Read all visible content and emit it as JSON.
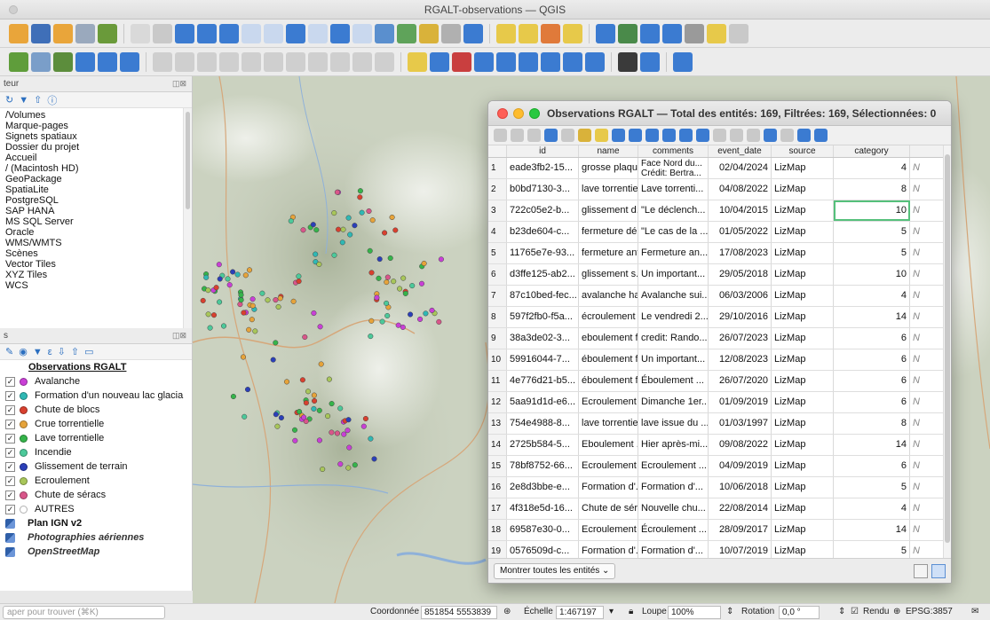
{
  "window": {
    "title": "RGALT-observations — QGIS"
  },
  "browser": {
    "title": "teur",
    "items": [
      "/Volumes",
      "Marque-pages",
      "Signets spatiaux",
      "Dossier du projet",
      "Accueil",
      "/ (Macintosh HD)",
      "GeoPackage",
      "SpatiaLite",
      "PostgreSQL",
      "SAP HANA",
      "MS SQL Server",
      "Oracle",
      "WMS/WMTS",
      "Scènes",
      "Vector Tiles",
      "XYZ Tiles",
      "WCS"
    ]
  },
  "layers": {
    "title": "s",
    "group": "Observations RGALT",
    "items": [
      {
        "label": "Avalanche",
        "color": "#c93fd6"
      },
      {
        "label": "Formation d'un nouveau lac glacia",
        "color": "#2fb8b4"
      },
      {
        "label": "Chute de blocs",
        "color": "#d8402f"
      },
      {
        "label": "Crue torrentielle",
        "color": "#e6a33a"
      },
      {
        "label": "Lave torrentielle",
        "color": "#35b44a"
      },
      {
        "label": "Incendie",
        "color": "#4cc99a"
      },
      {
        "label": "Glissement de terrain",
        "color": "#2b3fb8"
      },
      {
        "label": "Ecroulement",
        "color": "#a8c65a"
      },
      {
        "label": "Chute de séracs",
        "color": "#d9568a"
      },
      {
        "label": "AUTRES",
        "color": "#ffffff"
      }
    ],
    "basemaps": [
      "Plan IGN v2",
      "Photographies aériennes",
      "OpenStreetMap"
    ]
  },
  "attribute_table": {
    "title": "Observations RGALT — Total des entités: 169, Filtrées: 169, Sélectionnées: 0",
    "columns": [
      "id",
      "name",
      "comments",
      "event_date",
      "source",
      "category"
    ],
    "rows": [
      {
        "n": "1",
        "id": "eade3fb2-15...",
        "name": "grosse plaqu...",
        "comments": "Face Nord du...",
        "comments2": "Crédit: Bertra...",
        "date": "02/04/2024",
        "source": "LizMap",
        "category": "4",
        "extra": "N"
      },
      {
        "n": "2",
        "id": "b0bd7130-3...",
        "name": "lave torrentie...",
        "comments": "Lave torrenti...",
        "date": "04/08/2022",
        "source": "LizMap",
        "category": "8",
        "extra": "N"
      },
      {
        "n": "3",
        "id": "722c05e2-b...",
        "name": "glissement d...",
        "comments": "\"Le déclench...",
        "date": "10/04/2015",
        "source": "LizMap",
        "category": "10",
        "extra": "N"
      },
      {
        "n": "4",
        "id": "b23de604-c...",
        "name": "fermeture dé...",
        "comments": "\"Le cas de la ...",
        "date": "01/05/2022",
        "source": "LizMap",
        "category": "5",
        "extra": "N"
      },
      {
        "n": "5",
        "id": "11765e7e-93...",
        "name": "fermeture ant...",
        "comments": "Fermeture an...",
        "date": "17/08/2023",
        "source": "LizMap",
        "category": "5",
        "extra": "N"
      },
      {
        "n": "6",
        "id": "d3ffe125-ab2...",
        "name": "glissement s...",
        "comments": "Un important...",
        "date": "29/05/2018",
        "source": "LizMap",
        "category": "10",
        "extra": "N"
      },
      {
        "n": "7",
        "id": "87c10bed-fec...",
        "name": "avalanche ha...",
        "comments": "Avalanche sui...",
        "date": "06/03/2006",
        "source": "LizMap",
        "category": "4",
        "extra": "N"
      },
      {
        "n": "8",
        "id": "597f2fb0-f5a...",
        "name": "écroulement ...",
        "comments": "Le vendredi 2...",
        "date": "29/10/2016",
        "source": "LizMap",
        "category": "14",
        "extra": "N"
      },
      {
        "n": "9",
        "id": "38a3de02-3...",
        "name": "eboulement f...",
        "comments": "credit: Rando...",
        "date": "26/07/2023",
        "source": "LizMap",
        "category": "6",
        "extra": "N"
      },
      {
        "n": "10",
        "id": "59916044-7...",
        "name": "éboulement f...",
        "comments": "Un important...",
        "date": "12/08/2023",
        "source": "LizMap",
        "category": "6",
        "extra": "N"
      },
      {
        "n": "11",
        "id": "4e776d21-b5...",
        "name": "éboulement f...",
        "comments": "Éboulement ...",
        "date": "26/07/2020",
        "source": "LizMap",
        "category": "6",
        "extra": "N"
      },
      {
        "n": "12",
        "id": "5aa91d1d-e6...",
        "name": "Ecroulement ...",
        "comments": "Dimanche 1er...",
        "date": "01/09/2019",
        "source": "LizMap",
        "category": "6",
        "extra": "N"
      },
      {
        "n": "13",
        "id": "754e4988-8...",
        "name": "lave torrentie...",
        "comments": "lave issue du ...",
        "date": "01/03/1997",
        "source": "LizMap",
        "category": "8",
        "extra": "N"
      },
      {
        "n": "14",
        "id": "2725b584-5...",
        "name": "Eboulement ...",
        "comments": "Hier après-mi...",
        "date": "09/08/2022",
        "source": "LizMap",
        "category": "14",
        "extra": "N"
      },
      {
        "n": "15",
        "id": "78bf8752-66...",
        "name": "Ecroulement ...",
        "comments": "Ecroulement ...",
        "date": "04/09/2019",
        "source": "LizMap",
        "category": "6",
        "extra": "N"
      },
      {
        "n": "16",
        "id": "2e8d3bbe-e...",
        "name": "Formation d'...",
        "comments": "Formation d'...",
        "date": "10/06/2018",
        "source": "LizMap",
        "category": "5",
        "extra": "N"
      },
      {
        "n": "17",
        "id": "4f318e5d-16...",
        "name": "Chute de sér...",
        "comments": "Nouvelle chu...",
        "date": "22/08/2014",
        "source": "LizMap",
        "category": "4",
        "extra": "N"
      },
      {
        "n": "18",
        "id": "69587e30-0...",
        "name": "Ecroulement ...",
        "comments": "Écroulement ...",
        "date": "28/09/2017",
        "source": "LizMap",
        "category": "14",
        "extra": "N"
      },
      {
        "n": "19",
        "id": "0576509d-c...",
        "name": "Formation d'...",
        "comments": "Formation d'...",
        "date": "10/07/2019",
        "source": "LizMap",
        "category": "5",
        "extra": "N"
      }
    ],
    "show_all": "Montrer toutes les entités"
  },
  "status": {
    "search_placeholder": "aper pour trouver (⌘K)",
    "coord_label": "Coordonnée",
    "coord_value": "851854  5553839",
    "scale_label": "Échelle",
    "scale_value": "1:467197",
    "loupe_label": "Loupe",
    "loupe_value": "100%",
    "rotation_label": "Rotation",
    "rotation_value": "0,0 °",
    "render_label": "Rendu",
    "crs": "EPSG:3857"
  }
}
